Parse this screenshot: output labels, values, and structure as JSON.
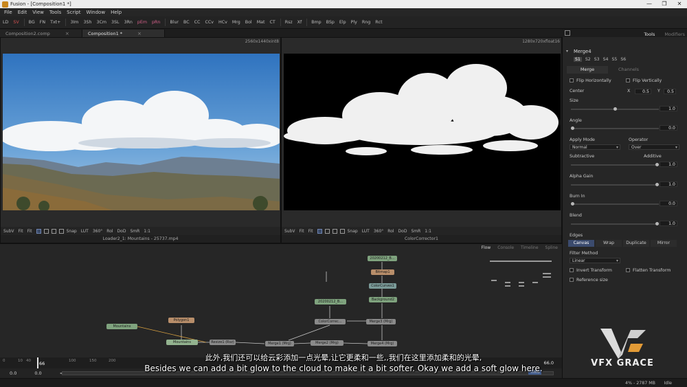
{
  "window": {
    "title": "Fusion - [Composition1 *]",
    "controls": [
      "—",
      "❐",
      "✕"
    ]
  },
  "menu": [
    "File",
    "Edit",
    "View",
    "Tools",
    "Script",
    "Window",
    "Help"
  ],
  "toolbar": [
    {
      "label": "LD",
      "color": "normal"
    },
    {
      "label": "SV",
      "color": "red"
    },
    {
      "label": "BG",
      "color": "normal"
    },
    {
      "label": "FN",
      "color": "normal"
    },
    {
      "label": "Txt+",
      "color": "normal"
    },
    {
      "label": "3Im",
      "color": "normal"
    },
    {
      "label": "3Sh",
      "color": "normal"
    },
    {
      "label": "3Cm",
      "color": "normal"
    },
    {
      "label": "3SL",
      "color": "normal"
    },
    {
      "label": "3Rn",
      "color": "normal"
    },
    {
      "label": "pEm",
      "color": "pink"
    },
    {
      "label": "pRn",
      "color": "pink"
    },
    {
      "label": "Blur",
      "color": "normal"
    },
    {
      "label": "BC",
      "color": "normal"
    },
    {
      "label": "CC",
      "color": "normal"
    },
    {
      "label": "CCv",
      "color": "normal"
    },
    {
      "label": "HCv",
      "color": "normal"
    },
    {
      "label": "Mrg",
      "color": "normal"
    },
    {
      "label": "Bol",
      "color": "normal"
    },
    {
      "label": "Mat",
      "color": "normal"
    },
    {
      "label": "CT",
      "color": "normal"
    },
    {
      "label": "Rsz",
      "color": "normal"
    },
    {
      "label": "Xf",
      "color": "normal"
    },
    {
      "label": "Bmp",
      "color": "normal"
    },
    {
      "label": "BSp",
      "color": "normal"
    },
    {
      "label": "Elp",
      "color": "normal"
    },
    {
      "label": "Ply",
      "color": "normal"
    },
    {
      "label": "Rng",
      "color": "normal"
    },
    {
      "label": "Rct",
      "color": "normal"
    }
  ],
  "tabs": [
    {
      "label": "Composition2.comp",
      "active": false
    },
    {
      "label": "Composition1 *",
      "active": true
    }
  ],
  "viewers": {
    "left": {
      "resolution": "2560x1440xint8",
      "name": "Loader2_1: Mountains - 25737.mp4",
      "bar": [
        "SubV",
        "Fit",
        "Fit",
        "Snap",
        "LUT",
        "360°",
        "Rol",
        "DoD",
        "SmR",
        "1:1"
      ]
    },
    "right": {
      "resolution": "1280x720xfloat16",
      "name": "ColorCorrector1",
      "bar": [
        "SubV",
        "Fit",
        "Fit",
        "Snap",
        "LUT",
        "360°",
        "Rol",
        "DoD",
        "SmR",
        "1:1"
      ]
    }
  },
  "flow": {
    "tabs": [
      "Flow",
      "Console",
      "Timeline",
      "Spline"
    ],
    "nodes": {
      "mountains_a": "Mountains",
      "polygon1": "Polygon1",
      "mountains_b": "Mountains",
      "resize1": "Resize1 (Rsz)",
      "merge1": "Merge1 (Mrg)",
      "merge2": "Merge2 (Mrg)",
      "merge4": "Merge4 (Mrg)",
      "clip_top": "20200212_B...",
      "bitmap1": "Bitmap1",
      "colorcurves1": "ColorCurves1",
      "background2": "Background2",
      "clip_mid": "20200212_B...",
      "colorcorrector": "ColorCorrec...",
      "merge3": "Merge3 (Mrg)"
    }
  },
  "timeline": {
    "ticks": [
      "0",
      "10",
      "40",
      "66",
      "100",
      "150",
      "200"
    ],
    "current": "66",
    "end": "66.0"
  },
  "transport": {
    "start": "0.0",
    "in": "0.0",
    "back": "<<",
    "time": "Time"
  },
  "status": {
    "memory": "4% - 2787 MB",
    "state": "Idle"
  },
  "inspector": {
    "tabs": [
      "Tools",
      "Modifiers"
    ],
    "node_name": "Merge4",
    "versions": [
      "S1",
      "S2",
      "S3",
      "S4",
      "S5",
      "S6"
    ],
    "subtabs": [
      "Merge",
      "Channels"
    ],
    "flip_horizontally": "Flip Horizontally",
    "flip_vertically": "Flip Vertically",
    "center": {
      "label": "Center",
      "x_label": "X",
      "x": "0.5",
      "y_label": "Y",
      "y": "0.5"
    },
    "size": {
      "label": "Size",
      "value": "1.0",
      "level": 0.5
    },
    "angle": {
      "label": "Angle",
      "value": "0.0",
      "level": 0.0
    },
    "apply_mode": {
      "label": "Apply Mode",
      "value": "Normal"
    },
    "operator": {
      "label": "Operator",
      "value": "Over"
    },
    "subtractive": "Subtractive",
    "additive": "Additive",
    "sub_add": {
      "value": "1.0",
      "level": 1.0
    },
    "alpha_gain": {
      "label": "Alpha Gain",
      "value": "1.0",
      "level": 1.0
    },
    "burn_in": {
      "label": "Burn In",
      "value": "0.0",
      "level": 0.0
    },
    "blend": {
      "label": "Blend",
      "value": "1.0",
      "level": 1.0
    },
    "edges": {
      "label": "Edges",
      "buttons": [
        "Canvas",
        "Wrap",
        "Duplicate",
        "Mirror"
      ]
    },
    "filter_method": {
      "label": "Filter Method",
      "value": "Linear"
    },
    "invert_transform": "Invert Transform",
    "flatten_transform": "Flatten Transform",
    "reference_size": "Reference size"
  },
  "subtitles": {
    "cn": "此外,我们还可以给云彩添加一点光晕,让它更柔和一些,,我们在这里添加柔和的光晕,",
    "en": "Besides we can add a bit glow to the cloud to make it a bit softer. Okay we add a soft glow here."
  },
  "watermark": "VFX GRACE"
}
